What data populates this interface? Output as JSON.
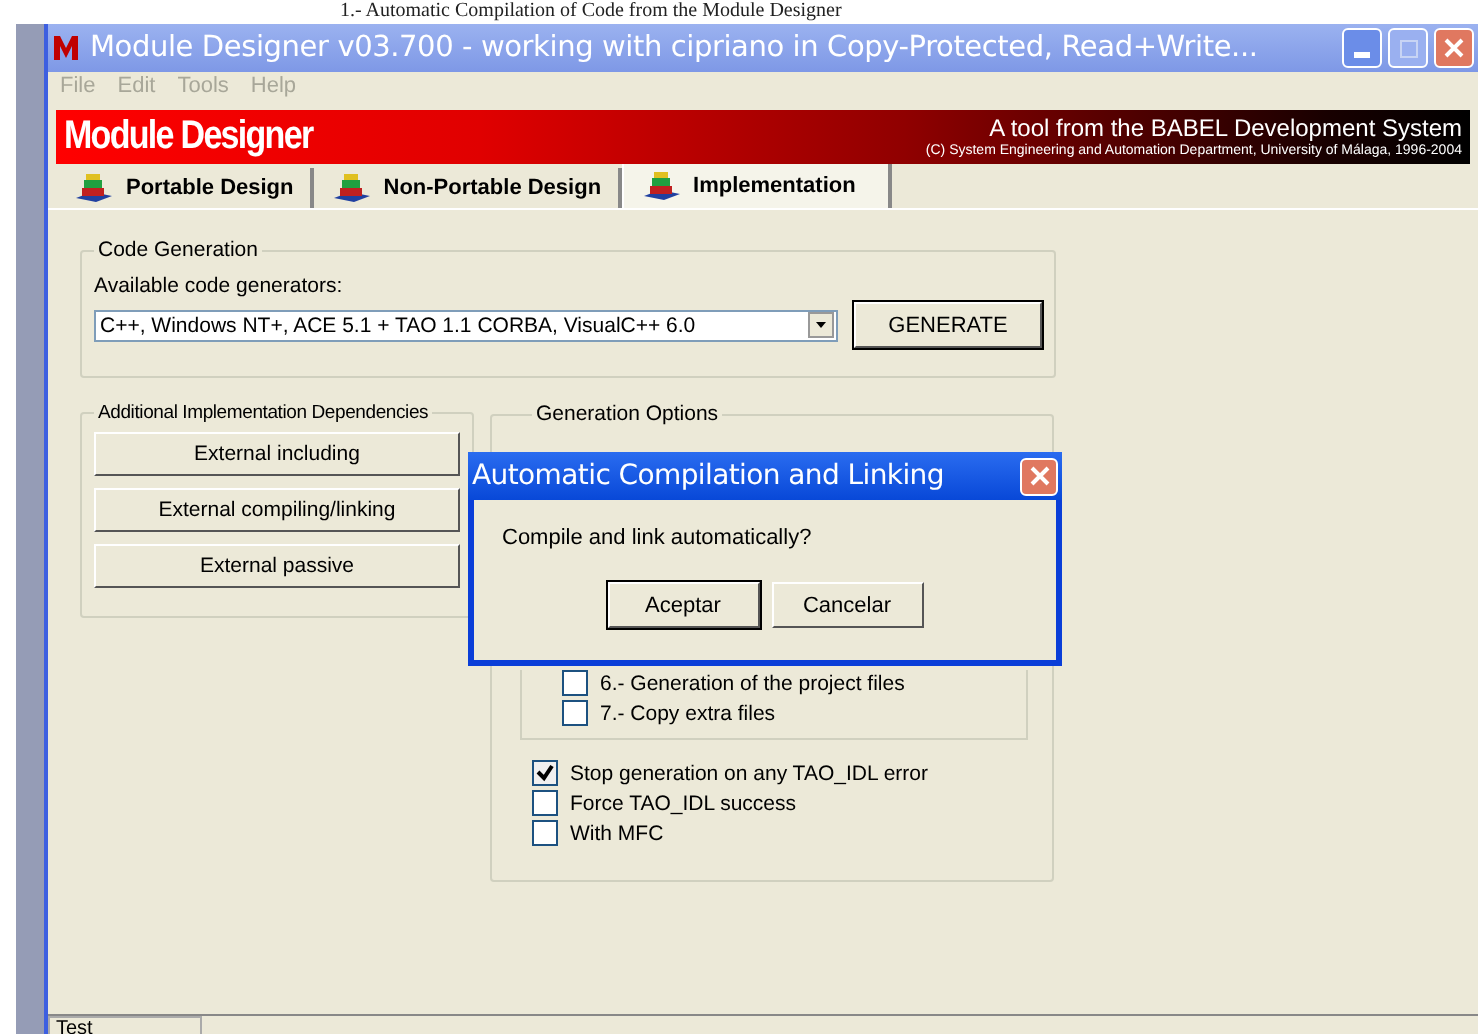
{
  "background_document": {
    "text": "1.- Automatic Compilation of Code from the Module Designer"
  },
  "window": {
    "title": "Module Designer v03.700 - working with cipriano in Copy-Protected, Read+Write..."
  },
  "menu": [
    {
      "label": "File",
      "disabled": true
    },
    {
      "label": "Edit",
      "disabled": true
    },
    {
      "label": "Tools",
      "disabled": true
    },
    {
      "label": "Help",
      "disabled": true
    }
  ],
  "banner": {
    "logo": "Module Designer",
    "tagline": "A tool from the BABEL Development System",
    "copyright": "(C) System Engineering and Automation Department, University of Málaga, 1996-2004"
  },
  "tabs": [
    {
      "label": "Portable Design",
      "selected": false
    },
    {
      "label": "Non-Portable Design",
      "selected": false
    },
    {
      "label": "Implementation",
      "selected": true
    }
  ],
  "code_generation": {
    "title": "Code Generation",
    "label": "Available code generators:",
    "value": "C++, Windows NT+, ACE 5.1 + TAO 1.1 CORBA, VisualC++ 6.0",
    "button": "GENERATE"
  },
  "dependencies": {
    "title": "Additional Implementation Dependencies",
    "buttons": [
      "External including",
      "External compiling/linking",
      "External passive"
    ]
  },
  "generation_options": {
    "title": "Generation Options",
    "steps": [
      {
        "label": "6.- Generation of the project files",
        "checked": false
      },
      {
        "label": "7.- Copy extra files",
        "checked": false
      }
    ],
    "options": [
      {
        "label": "Stop generation on any TAO_IDL error",
        "checked": true
      },
      {
        "label": "Force TAO_IDL success",
        "checked": false
      },
      {
        "label": "With MFC",
        "checked": false
      }
    ]
  },
  "dialog": {
    "title": "Automatic Compilation and Linking",
    "message": "Compile and link automatically?",
    "buttons": [
      {
        "label": "Aceptar",
        "default": true
      },
      {
        "label": "Cancelar",
        "default": false
      }
    ]
  },
  "status_bar": {
    "text": "Test"
  }
}
